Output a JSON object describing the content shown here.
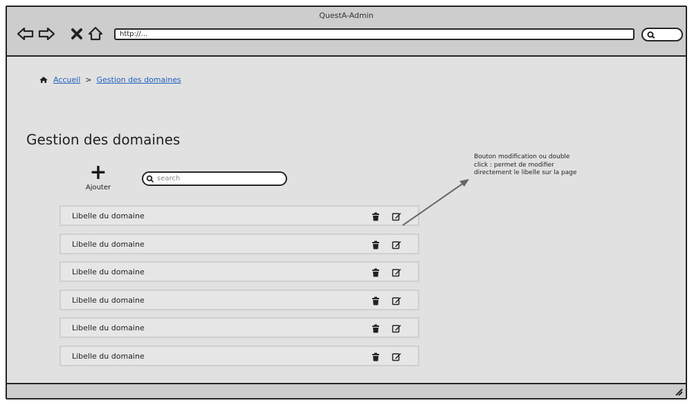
{
  "window": {
    "title": "QuestA-Admin"
  },
  "browser": {
    "icons": [
      "back-arrow-icon",
      "forward-arrow-icon",
      "close-x-icon",
      "home-icon",
      "search-icon"
    ],
    "url": "http://..."
  },
  "breadcrumb": {
    "icon": "home-icon",
    "home": "Accueil",
    "separator": ">",
    "current": "Gestion des domaines"
  },
  "page": {
    "title": "Gestion des domaines"
  },
  "toolbar": {
    "add_label": "Ajouter",
    "add_icon": "plus-icon",
    "search_placeholder": "search"
  },
  "domains": [
    {
      "label": "Libelle du domaine"
    },
    {
      "label": "Libelle du domaine"
    },
    {
      "label": "Libelle du domaine"
    },
    {
      "label": "Libelle du domaine"
    },
    {
      "label": "Libelle du domaine"
    },
    {
      "label": "Libelle du domaine"
    }
  ],
  "row_icons": [
    "trash-icon",
    "edit-icon"
  ],
  "annotation": {
    "text": "Bouton modification ou double click : permet de modifier directement le libelle sur la page"
  },
  "colors": {
    "background": "#e1e1e1",
    "chrome": "#cdcdcd",
    "link": "#1f5fbf",
    "row": "#e6e6e6"
  }
}
